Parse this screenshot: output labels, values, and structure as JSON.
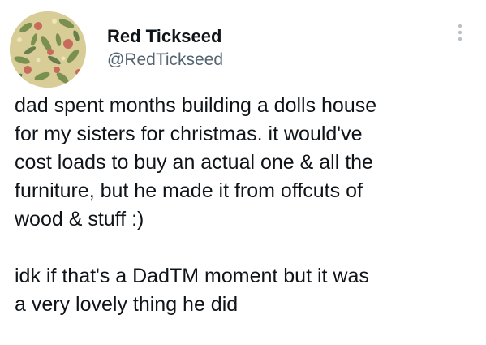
{
  "author": {
    "display_name": "Red Tickseed",
    "handle": "@RedTickseed",
    "avatar_icon": "floral-pattern-avatar"
  },
  "menu": {
    "icon": "more-vertical-icon"
  },
  "tweet": {
    "paragraph1": [
      "dad spent months building a dolls house",
      "for my sisters for christmas. it would've",
      "cost loads to buy an actual one & all the",
      "furniture, but he made it from offcuts of",
      "wood & stuff :)"
    ],
    "paragraph2": [
      "idk if that's a DadTM moment but it was",
      "a very lovely thing he did"
    ]
  },
  "colors": {
    "text": "#0f1419",
    "secondary_text": "#536471",
    "avatar_bg": "#d9cf98"
  }
}
